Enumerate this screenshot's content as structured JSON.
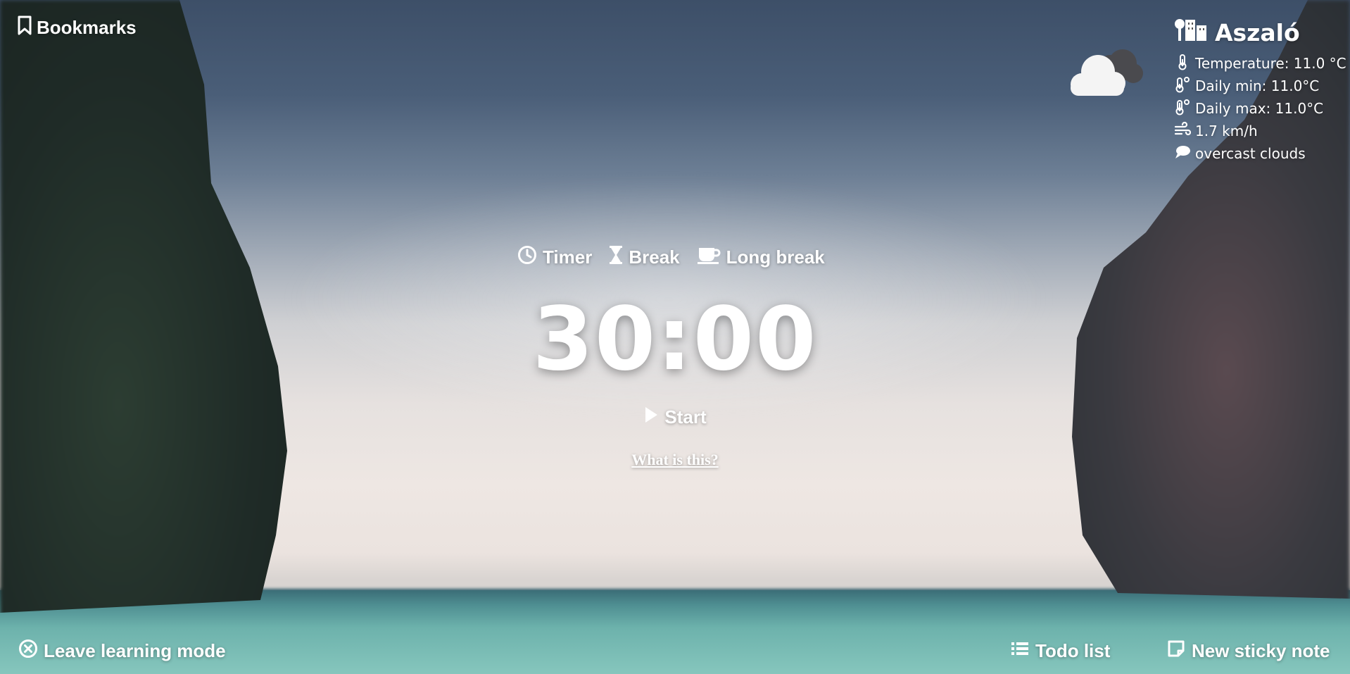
{
  "bookmarks": {
    "label": "Bookmarks",
    "icon": "bookmark-icon"
  },
  "weather": {
    "city": "Aszaló",
    "condition_icon": "overcast-cloud-icon",
    "temperature": "Temperature: 11.0 °C",
    "daily_min": "Daily min: 11.0°C",
    "daily_max": "Daily max: 11.0°C",
    "wind": "1.7 km/h",
    "description": "overcast clouds"
  },
  "timer": {
    "modes": [
      {
        "label": "Timer",
        "icon": "clock-icon"
      },
      {
        "label": "Break",
        "icon": "hourglass-icon"
      },
      {
        "label": "Long break",
        "icon": "coffee-cup-icon"
      }
    ],
    "display": "30:00",
    "start_label": "Start",
    "help_link": "What is this?"
  },
  "footer": {
    "leave_label": "Leave learning mode",
    "todo_label": "Todo list",
    "sticky_label": "New sticky note"
  },
  "colors": {
    "text": "#ffffff",
    "sky_top": "#3d4f68",
    "sea": "#6db2ac"
  }
}
